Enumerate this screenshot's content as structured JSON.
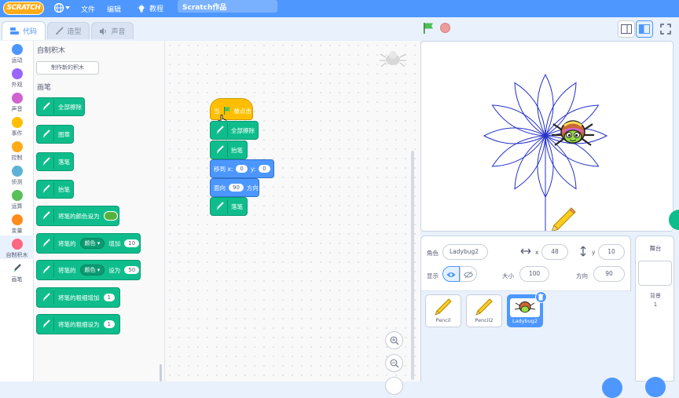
{
  "menubar": {
    "logo": "SCRATCH",
    "file": "文件",
    "edit": "编辑",
    "tutorials": "教程",
    "project_title": "Scratch作品"
  },
  "tabs": {
    "code": "代码",
    "costumes": "造型",
    "sounds": "声音"
  },
  "categories": [
    {
      "label": "运动",
      "color": "#4c97ff"
    },
    {
      "label": "外观",
      "color": "#9966ff"
    },
    {
      "label": "声音",
      "color": "#cf63cf"
    },
    {
      "label": "事件",
      "color": "#ffbf00"
    },
    {
      "label": "控制",
      "color": "#ffab19"
    },
    {
      "label": "侦测",
      "color": "#5cb1d6"
    },
    {
      "label": "运算",
      "color": "#59c059"
    },
    {
      "label": "变量",
      "color": "#ff8c1a"
    },
    {
      "label": "自制积木",
      "color": "#ff6680"
    },
    {
      "label": "画笔",
      "color": "#0fbd8c"
    }
  ],
  "palette": {
    "my_blocks_title": "自制积木",
    "make_block": "制作新的积木",
    "pen_title": "画笔",
    "blocks": {
      "erase_all": "全部擦除",
      "stamp": "图章",
      "pen_down": "落笔",
      "pen_up": "抬笔",
      "set_color_to": "将笔的颜色设为",
      "pen_of": "将笔的",
      "color_option": "颜色",
      "change_by": "增加",
      "change_value": "10",
      "set_to": "设为",
      "set_value": "50",
      "size_change": "将笔的粗细增加",
      "size_change_value": "1",
      "size_set": "将笔的粗细设为",
      "size_set_value": "1"
    }
  },
  "script": {
    "when_clicked_prefix": "当",
    "when_clicked_suffix": "被点击",
    "erase_all": "全部擦除",
    "pen_up": "抬笔",
    "goto_label": "移到 x:",
    "goto_x": "0",
    "goto_y_label": "y:",
    "goto_y": "0",
    "point_label": "面向",
    "point_value": "90",
    "point_suffix": "方向",
    "pen_down": "落笔"
  },
  "sprite_info": {
    "sprite_label": "角色",
    "sprite_name": "Ladybug2",
    "x_label": "x",
    "x_value": "48",
    "y_label": "y",
    "y_value": "10",
    "show_label": "显示",
    "size_label": "大小",
    "size_value": "100",
    "direction_label": "方向",
    "direction_value": "90"
  },
  "sprites": [
    {
      "name": "Pencil",
      "selected": false
    },
    {
      "name": "Pencil2",
      "selected": false
    },
    {
      "name": "Ladybug2",
      "selected": true
    }
  ],
  "stage_panel": {
    "title": "舞台",
    "backdrops_label": "背景",
    "backdrops_count": "1"
  },
  "colors": {
    "accent": "#4d97ff",
    "pen": "#0fbd8c",
    "motion": "#4c97ff",
    "events": "#ffbf00"
  }
}
